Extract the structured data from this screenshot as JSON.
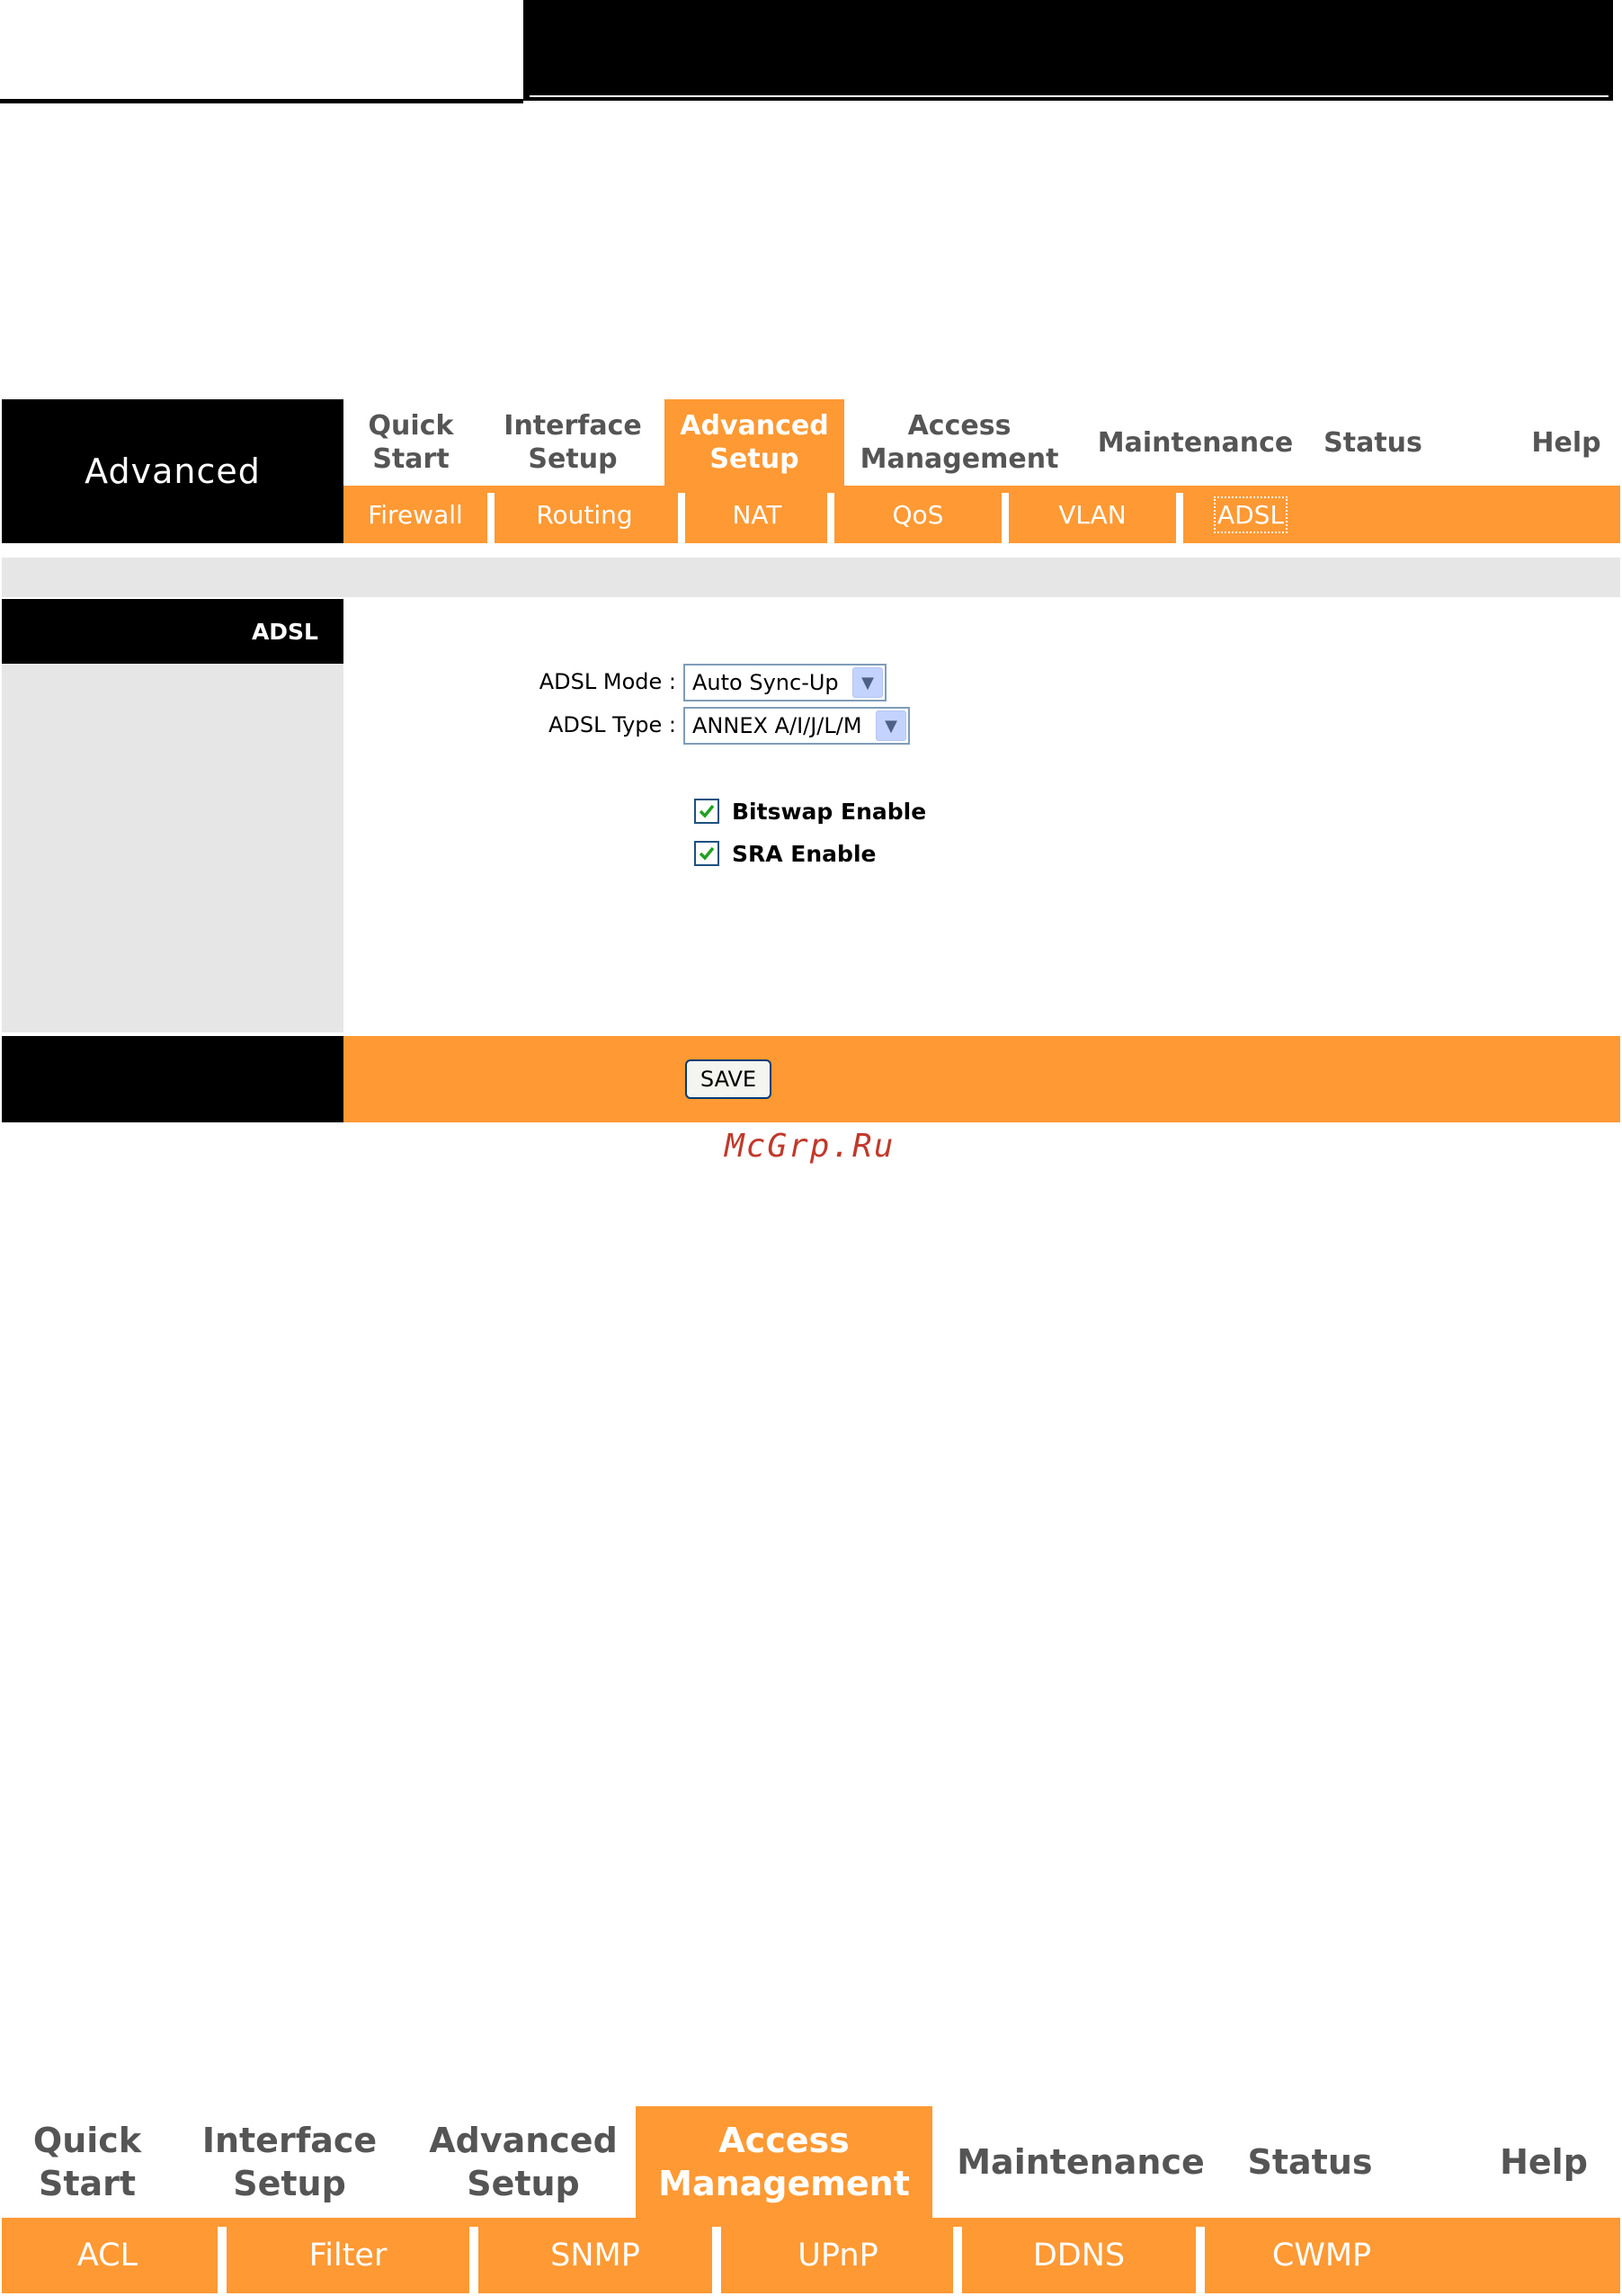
{
  "top_menu": {
    "brand": "Advanced",
    "tabs": [
      {
        "label": "Quick\nStart",
        "active": false
      },
      {
        "label": "Interface\nSetup",
        "active": false
      },
      {
        "label": "Advanced\nSetup",
        "active": true
      },
      {
        "label": "Access\nManagement",
        "active": false
      },
      {
        "label": "Maintenance",
        "active": false
      },
      {
        "label": "Status",
        "active": false
      },
      {
        "label": "Help",
        "active": false
      }
    ],
    "subtabs": [
      {
        "label": "Firewall",
        "selected": false
      },
      {
        "label": "Routing",
        "selected": false
      },
      {
        "label": "NAT",
        "selected": false
      },
      {
        "label": "QoS",
        "selected": false
      },
      {
        "label": "VLAN",
        "selected": false
      },
      {
        "label": "ADSL",
        "selected": true
      }
    ]
  },
  "sidebar": {
    "section": "ADSL"
  },
  "form": {
    "mode_label": "ADSL Mode :",
    "mode_value": "Auto Sync-Up",
    "type_label": "ADSL Type :",
    "type_value": "ANNEX A/I/J/L/M",
    "bitswap_label": "Bitswap Enable",
    "bitswap_checked": true,
    "sra_label": "SRA Enable",
    "sra_checked": true,
    "save_label": "SAVE"
  },
  "watermark": "McGrp.Ru",
  "second_menu": {
    "tabs": [
      {
        "label": "Quick\nStart",
        "active": false
      },
      {
        "label": "Interface\nSetup",
        "active": false
      },
      {
        "label": "Advanced\nSetup",
        "active": false
      },
      {
        "label": "Access\nManagement",
        "active": true
      },
      {
        "label": "Maintenance",
        "active": false
      },
      {
        "label": "Status",
        "active": false
      },
      {
        "label": "Help",
        "active": false
      }
    ],
    "subtabs": [
      {
        "label": "ACL"
      },
      {
        "label": "Filter"
      },
      {
        "label": "SNMP"
      },
      {
        "label": "UPnP"
      },
      {
        "label": "DDNS"
      },
      {
        "label": "CWMP"
      }
    ]
  },
  "colors": {
    "accent_orange": "#ff9933",
    "panel_grey": "#e6e6e6",
    "black": "#000000"
  }
}
